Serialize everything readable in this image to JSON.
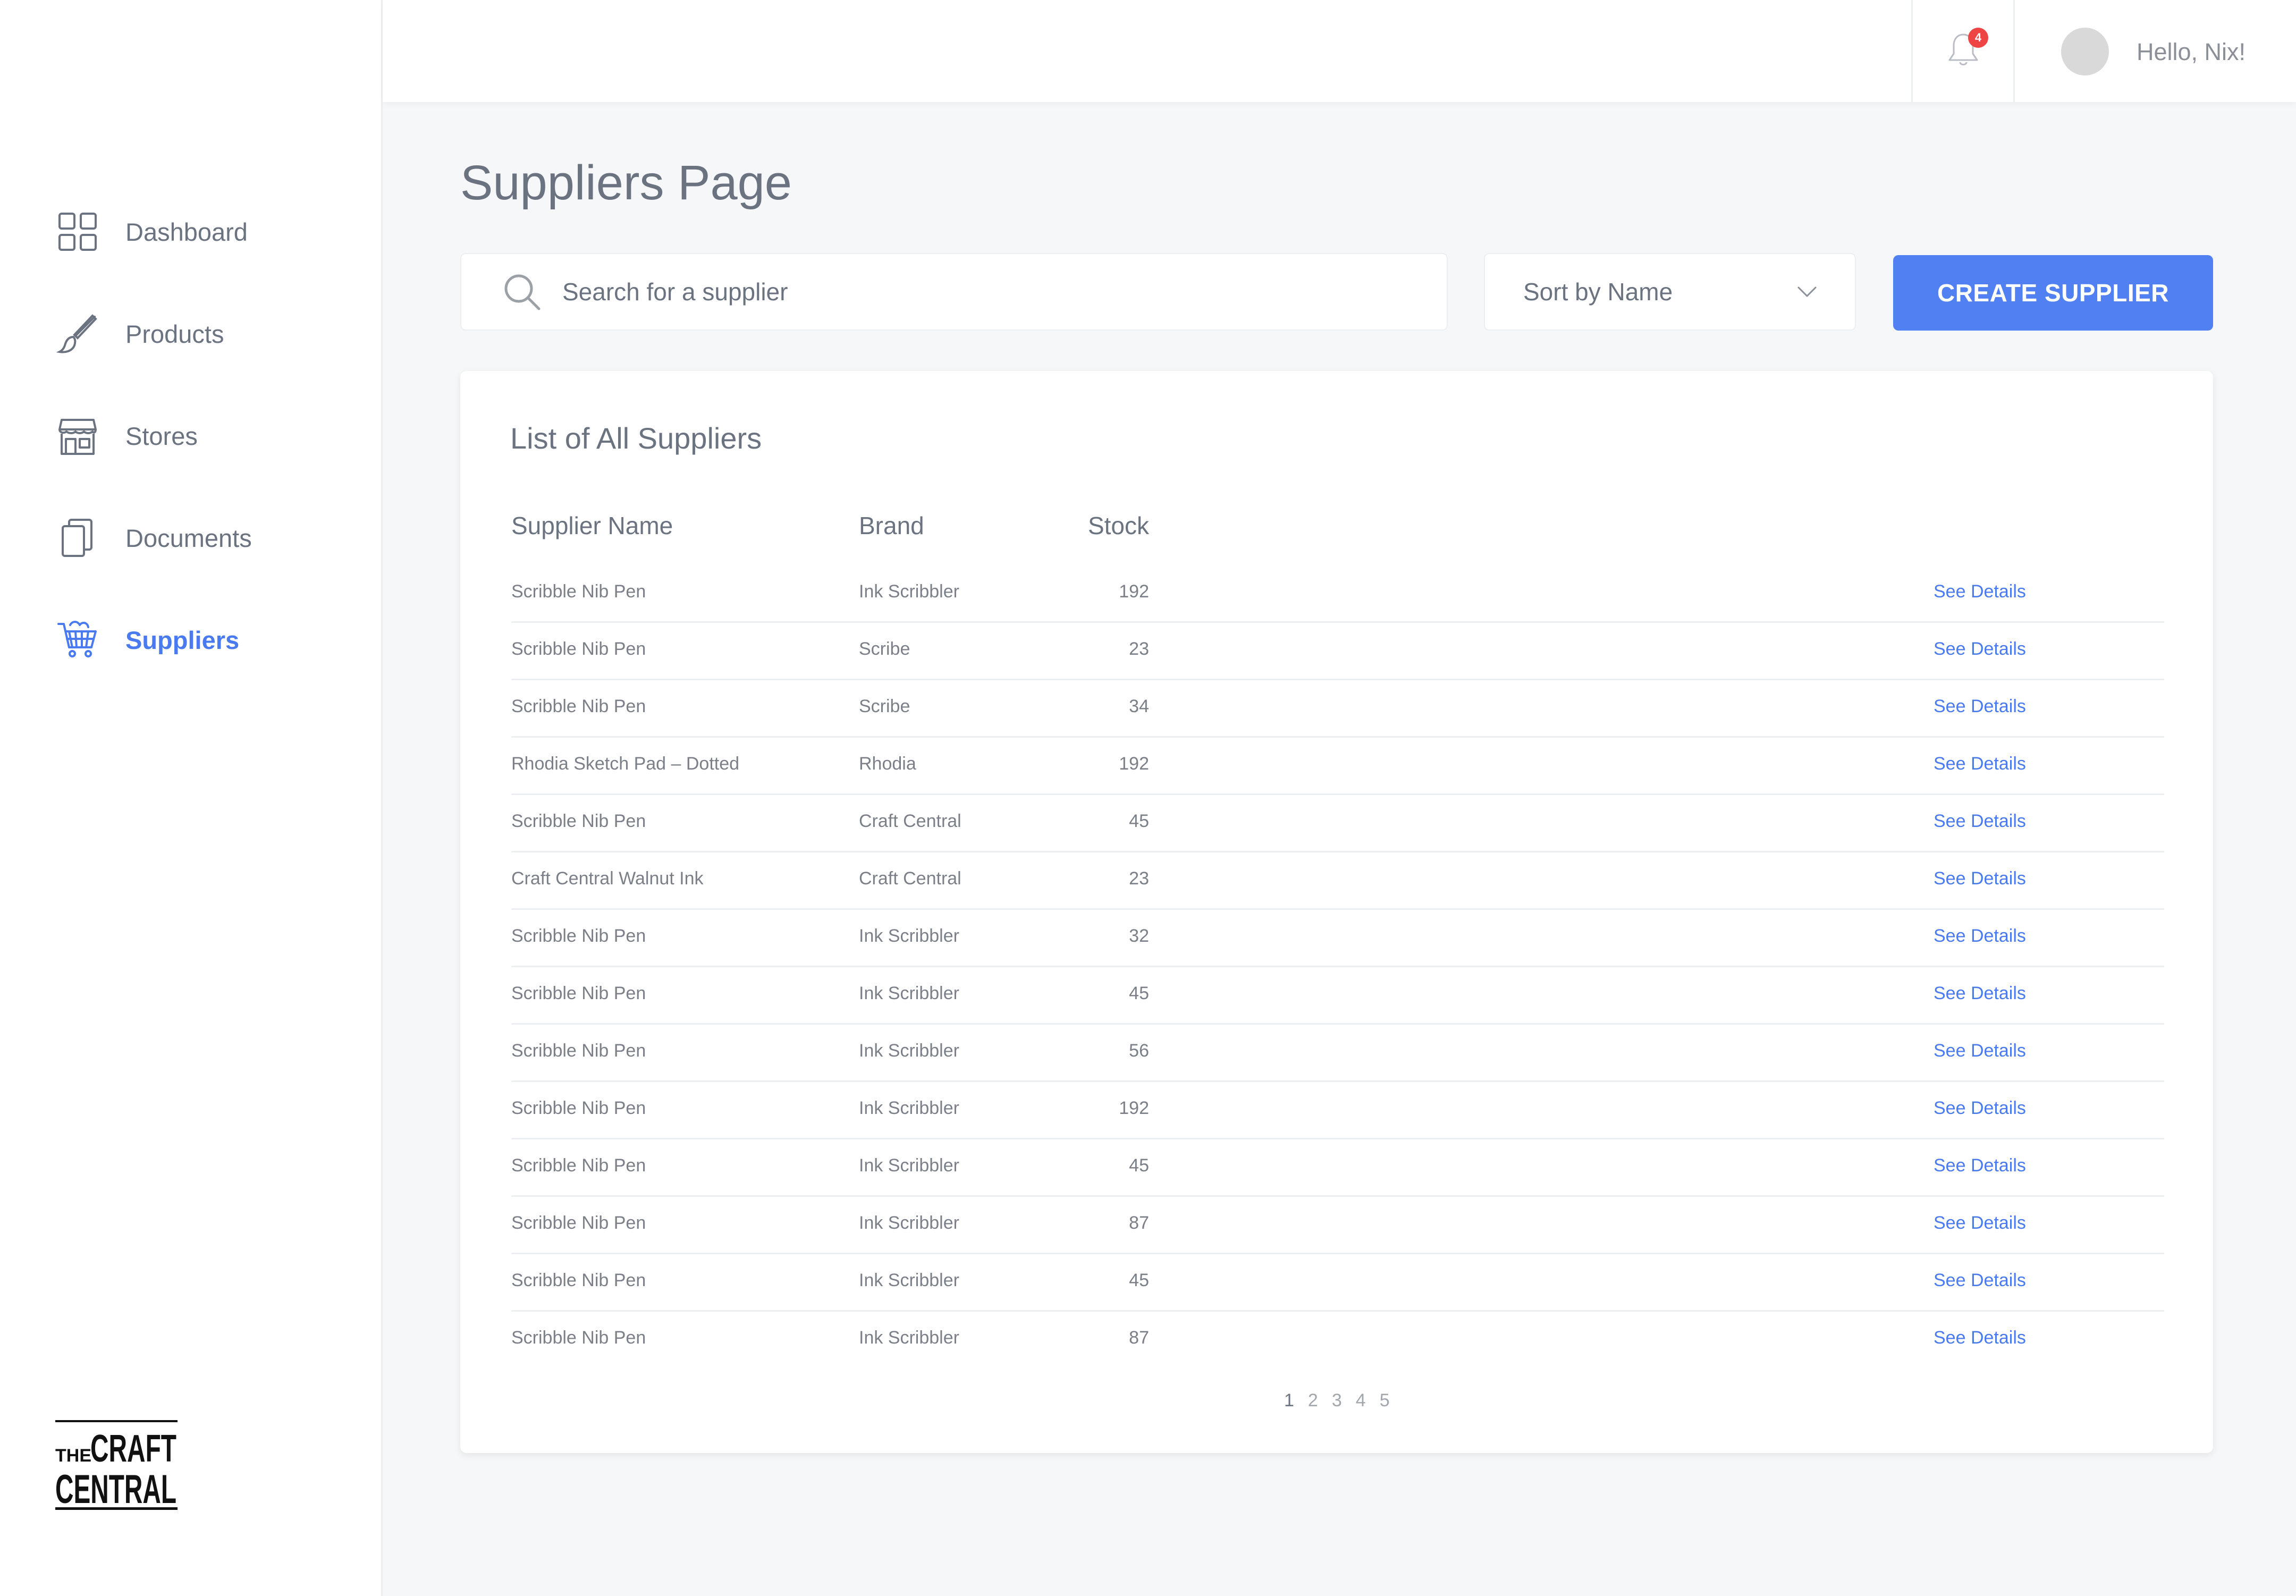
{
  "sidebar": {
    "items": [
      {
        "label": "Dashboard",
        "icon": "grid-icon"
      },
      {
        "label": "Products",
        "icon": "brush-icon"
      },
      {
        "label": "Stores",
        "icon": "store-icon"
      },
      {
        "label": "Documents",
        "icon": "documents-icon"
      },
      {
        "label": "Suppliers",
        "icon": "cart-icon",
        "active": true
      }
    ],
    "logo": {
      "line1_small": "THE",
      "line1_big": "CRAFT",
      "line2": "CENTRAL"
    }
  },
  "topbar": {
    "notification_count": "4",
    "greeting": "Hello, Nix!"
  },
  "main": {
    "title": "Suppliers Page",
    "search_placeholder": "Search for a supplier",
    "sort_label": "Sort by Name",
    "create_label": "CREATE SUPPLIER",
    "card_title": "List of All Suppliers",
    "columns": {
      "name": "Supplier Name",
      "brand": "Brand",
      "stock": "Stock"
    },
    "rows": [
      {
        "name": "Scribble Nib Pen",
        "brand": "Ink Scribbler",
        "stock": "192",
        "link": "See Details"
      },
      {
        "name": "Scribble Nib Pen",
        "brand": "Scribe",
        "stock": "23",
        "link": "See Details"
      },
      {
        "name": "Scribble Nib Pen",
        "brand": "Scribe",
        "stock": "34",
        "link": "See Details"
      },
      {
        "name": "Rhodia Sketch Pad – Dotted",
        "brand": "Rhodia",
        "stock": "192",
        "link": "See Details"
      },
      {
        "name": "Scribble Nib Pen",
        "brand": "Craft Central",
        "stock": "45",
        "link": "See Details"
      },
      {
        "name": "Craft Central Walnut Ink",
        "brand": "Craft Central",
        "stock": "23",
        "link": "See Details"
      },
      {
        "name": "Scribble Nib Pen",
        "brand": "Ink Scribbler",
        "stock": "32",
        "link": "See Details"
      },
      {
        "name": "Scribble Nib Pen",
        "brand": "Ink Scribbler",
        "stock": "45",
        "link": "See Details"
      },
      {
        "name": "Scribble Nib Pen",
        "brand": "Ink Scribbler",
        "stock": "56",
        "link": "See Details"
      },
      {
        "name": "Scribble Nib Pen",
        "brand": "Ink Scribbler",
        "stock": "192",
        "link": "See Details"
      },
      {
        "name": "Scribble Nib Pen",
        "brand": "Ink Scribbler",
        "stock": "45",
        "link": "See Details"
      },
      {
        "name": "Scribble Nib Pen",
        "brand": "Ink Scribbler",
        "stock": "87",
        "link": "See Details"
      },
      {
        "name": "Scribble Nib Pen",
        "brand": "Ink Scribbler",
        "stock": "45",
        "link": "See Details"
      },
      {
        "name": "Scribble Nib Pen",
        "brand": "Ink Scribbler",
        "stock": "87",
        "link": "See Details"
      }
    ],
    "pages": [
      "1",
      "2",
      "3",
      "4",
      "5"
    ],
    "current_page": "1"
  },
  "colors": {
    "accent": "#4a7aef",
    "button": "#5080f1",
    "badge": "#ef4444",
    "background": "#f6f7f9"
  }
}
